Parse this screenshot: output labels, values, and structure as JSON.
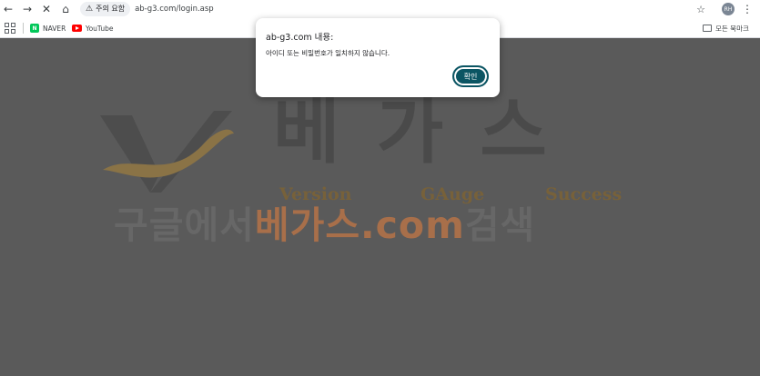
{
  "toolbar": {
    "back_glyph": "←",
    "forward_glyph": "→",
    "stop_glyph": "✕",
    "home_glyph": "⌂",
    "site_warning": "주의 요함",
    "url": "ab-g3.com/login.asp",
    "star_glyph": "☆",
    "profile_initials": "RH",
    "menu_glyph": "⋮"
  },
  "bookmarks": {
    "items": [
      {
        "label": "NAVER",
        "icon": "naver-icon"
      },
      {
        "label": "YouTube",
        "icon": "youtube-icon"
      }
    ],
    "all_bookmarks": "모든 북마크"
  },
  "page": {
    "brand": "베가스",
    "subtitle": [
      "Version",
      "GAuge",
      "Success"
    ],
    "banner_prefix": "구글에서 ",
    "banner_highlight": "베가스.com",
    "banner_suffix": " 검색",
    "colors": {
      "background": "#5a5a5a",
      "gold": "#77613a",
      "highlight": "#a86f4a"
    }
  },
  "dialog": {
    "title": "ab-g3.com 내용:",
    "message": "아이디 또는 비밀번호가 일치하지 않습니다.",
    "ok_label": "확인",
    "button_color": "#0b5563"
  }
}
